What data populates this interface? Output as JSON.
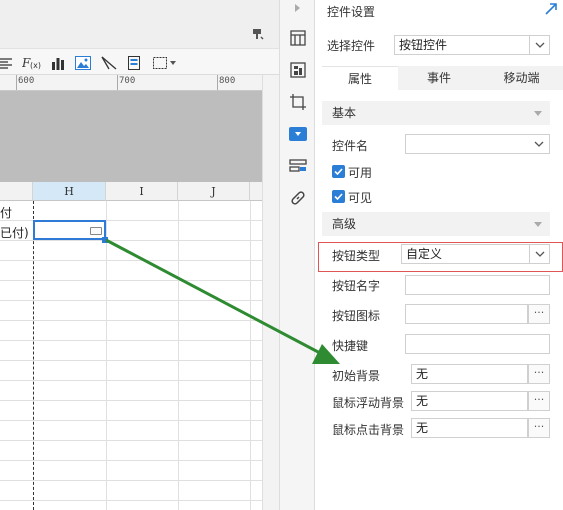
{
  "ruler": {
    "marks": [
      "600",
      "700",
      "800"
    ]
  },
  "grid": {
    "columns": [
      "H",
      "I",
      "J"
    ],
    "cells": [
      "付",
      "已付)"
    ]
  },
  "panel": {
    "title": "控件设置",
    "select_control_label": "选择控件",
    "select_control_value": "按钮控件",
    "tabs": [
      "属性",
      "事件",
      "移动端"
    ],
    "section_basic": "基本",
    "control_name_label": "控件名",
    "control_name_value": "",
    "enabled_label": "可用",
    "visible_label": "可见",
    "section_advanced": "高级",
    "button_type_label": "按钮类型",
    "button_type_value": "自定义",
    "button_name_label": "按钮名字",
    "button_name_value": "",
    "button_icon_label": "按钮图标",
    "button_icon_value": "",
    "shortcut_label": "快捷键",
    "shortcut_value": "",
    "initial_bg_label": "初始背景",
    "initial_bg_value": "无",
    "hover_bg_label": "鼠标浮动背景",
    "hover_bg_value": "无",
    "click_bg_label": "鼠标点击背景",
    "click_bg_value": "无",
    "ellipsis": "···"
  },
  "colors": {
    "accent": "#2a7ed6",
    "highlight_box": "#e05555",
    "arrow": "#2e8b32",
    "selected_column": "#d4e8f7"
  }
}
